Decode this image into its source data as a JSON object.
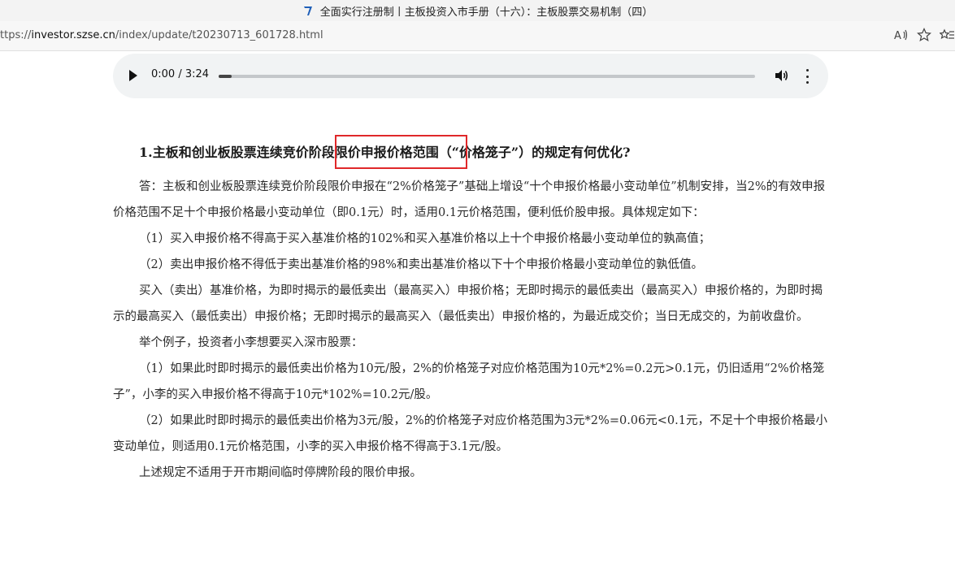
{
  "window": {
    "title": "全面实行注册制丨主板投资入市手册（十六）：主板股票交易机制（四）",
    "favicon": "szse-logo-icon"
  },
  "addressbar": {
    "url_prefix": "ttps://",
    "url_host": "investor.szse.cn",
    "url_path": "/index/update/t20230713_601728.html",
    "icons": [
      "read-aloud-icon",
      "favorite-star-icon",
      "collections-icon"
    ]
  },
  "audio": {
    "time": "0:00 / 3:24",
    "progress": 0.0,
    "icons": [
      "play-icon",
      "volume-icon",
      "more-options-icon"
    ]
  },
  "article": {
    "heading": "1.主板和创业板股票连续竞价阶段限价申报价格范围（“价格笼子”）的规定有何优化?",
    "paragraphs": [
      "答：主板和创业板股票连续竞价阶段限价申报在“2%价格笼子”基础上增设“十个申报价格最小变动单位”机制安排，当2%的有效申报价格范围不足十个申报价格最小变动单位（即0.1元）时，适用0.1元价格范围，便利低价股申报。具体规定如下：",
      "（1）买入申报价格不得高于买入基准价格的102%和买入基准价格以上十个申报价格最小变动单位的孰高值；",
      "（2）卖出申报价格不得低于卖出基准价格的98%和卖出基准价格以下十个申报价格最小变动单位的孰低值。",
      "买入（卖出）基准价格，为即时揭示的最低卖出（最高买入）申报价格；无即时揭示的最低卖出（最高买入）申报价格的，为即时揭示的最高买入（最低卖出）申报价格；无即时揭示的最高买入（最低卖出）申报价格的，为最近成交价；当日无成交的，为前收盘价。",
      "举个例子，投资者小李想要买入深市股票：",
      "（1）如果此时即时揭示的最低卖出价格为10元/股，2%的价格笼子对应价格范围为10元*2%=0.2元>0.1元，仍旧适用“2%价格笼子”，小李的买入申报价格不得高于10元*102%=10.2元/股。",
      "（2）如果此时即时揭示的最低卖出价格为3元/股，2%的价格笼子对应价格范围为3元*2%=0.06元<0.1元，不足十个申报价格最小变动单位，则适用0.1元价格范围，小李的买入申报价格不得高于3.1元/股。",
      "上述规定不适用于开市期间临时停牌阶段的限价申报。"
    ]
  },
  "annotation": {
    "color": "#e0282a"
  }
}
